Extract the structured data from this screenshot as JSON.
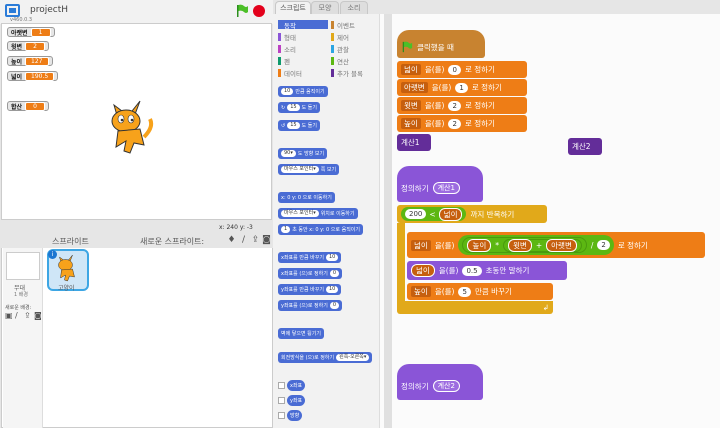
{
  "project": {
    "title": "projectH",
    "version": "v460.0.3"
  },
  "monitors": [
    {
      "name": "아랫변",
      "value": "1"
    },
    {
      "name": "윗변",
      "value": "2"
    },
    {
      "name": "높이",
      "value": "127"
    },
    {
      "name": "넓이",
      "value": "190.5"
    },
    {
      "name": "합산",
      "value": "0"
    }
  ],
  "coords": {
    "text": "x: 240  y: -3"
  },
  "sprites_panel": {
    "title": "스프라이트",
    "new_sprite": "새로운 스프라이트:",
    "stage_label": "무대",
    "stage_sub": "1 배경",
    "new_backdrop": "새로운 배경:",
    "sprite_name": "고양이"
  },
  "tabs": [
    "스크립트",
    "모양",
    "소리"
  ],
  "categories": [
    {
      "label": "동작",
      "color": "#4a6cd4"
    },
    {
      "label": "이벤트",
      "color": "#c88330"
    },
    {
      "label": "형태",
      "color": "#8a55d7"
    },
    {
      "label": "제어",
      "color": "#e1a91a"
    },
    {
      "label": "소리",
      "color": "#bb42c3"
    },
    {
      "label": "관찰",
      "color": "#2ca5e2"
    },
    {
      "label": "펜",
      "color": "#0e9a6c"
    },
    {
      "label": "연산",
      "color": "#5cb712"
    },
    {
      "label": "데이터",
      "color": "#ee7d16"
    },
    {
      "label": "추가 블록",
      "color": "#632d99"
    }
  ],
  "palette": [
    {
      "text": "만큼 움직이기",
      "input": "10"
    },
    {
      "text": "도 돌기",
      "input": "15",
      "icon": "↻"
    },
    {
      "text": "도 돌기",
      "input": "15",
      "icon": "↺"
    },
    {
      "text": "도 방향 보기",
      "input": "90▾"
    },
    {
      "text": "쪽 보기",
      "input": "마우스 포인터▾"
    },
    {
      "text": "x: 0 y: 0 으로 이동하기",
      "input": ""
    },
    {
      "text": "위치로 이동하기",
      "input": "마우스 포인터▾"
    },
    {
      "text": "초 동안 x: 0 y: 0 으로 움직이기",
      "input": "1"
    },
    {
      "text": "x좌표를 만큼 바꾸기",
      "input": "10"
    },
    {
      "text": "x좌표를 (으)로 정하기",
      "input": "0"
    },
    {
      "text": "y좌표를 만큼 바꾸기",
      "input": "10"
    },
    {
      "text": "y좌표를 (으)로 정하기",
      "input": "0"
    },
    {
      "text": "벽에 닿으면 튕기기",
      "input": ""
    },
    {
      "text": "회전방식을 (으)로 정하기",
      "input": "왼쪽-오른쪽▾"
    }
  ],
  "reporters": [
    "x좌표",
    "y좌표",
    "방향"
  ],
  "script": {
    "flag_hat": "클릭했을 때",
    "set1": {
      "var": "넓이",
      "mid": "을(를)",
      "val": "0",
      "tail": "로 정하기"
    },
    "set2": {
      "var": "아랫변",
      "mid": "을(를)",
      "val": "1",
      "tail": "로 정하기"
    },
    "set3": {
      "var": "윗변",
      "mid": "을(를)",
      "val": "2",
      "tail": "로 정하기"
    },
    "set4": {
      "var": "높이",
      "mid": "을(를)",
      "val": "2",
      "tail": "로 정하기"
    },
    "call1": "계산1",
    "call2": "계산2",
    "define1": {
      "label": "정의하기",
      "name": "계산1"
    },
    "repeat": {
      "left": "200",
      "op": "<",
      "right": "넓이",
      "tail": "까지 반복하기"
    },
    "inner_set": {
      "var": "넓이",
      "mid": "을(를)",
      "a": "높이",
      "times": "*",
      "b": "윗변",
      "plus": "+",
      "c": "아랫변",
      "div": "/",
      "d": "2",
      "tail": "로 정하기"
    },
    "say": {
      "var": "넓이",
      "mid": "을(를)",
      "val": "0.5",
      "tail": "초동안 말하기"
    },
    "change": {
      "var": "높이",
      "mid": "을(를)",
      "val": "5",
      "tail": "만큼 바꾸기"
    },
    "define2": {
      "label": "정의하기",
      "name": "계산2"
    }
  }
}
